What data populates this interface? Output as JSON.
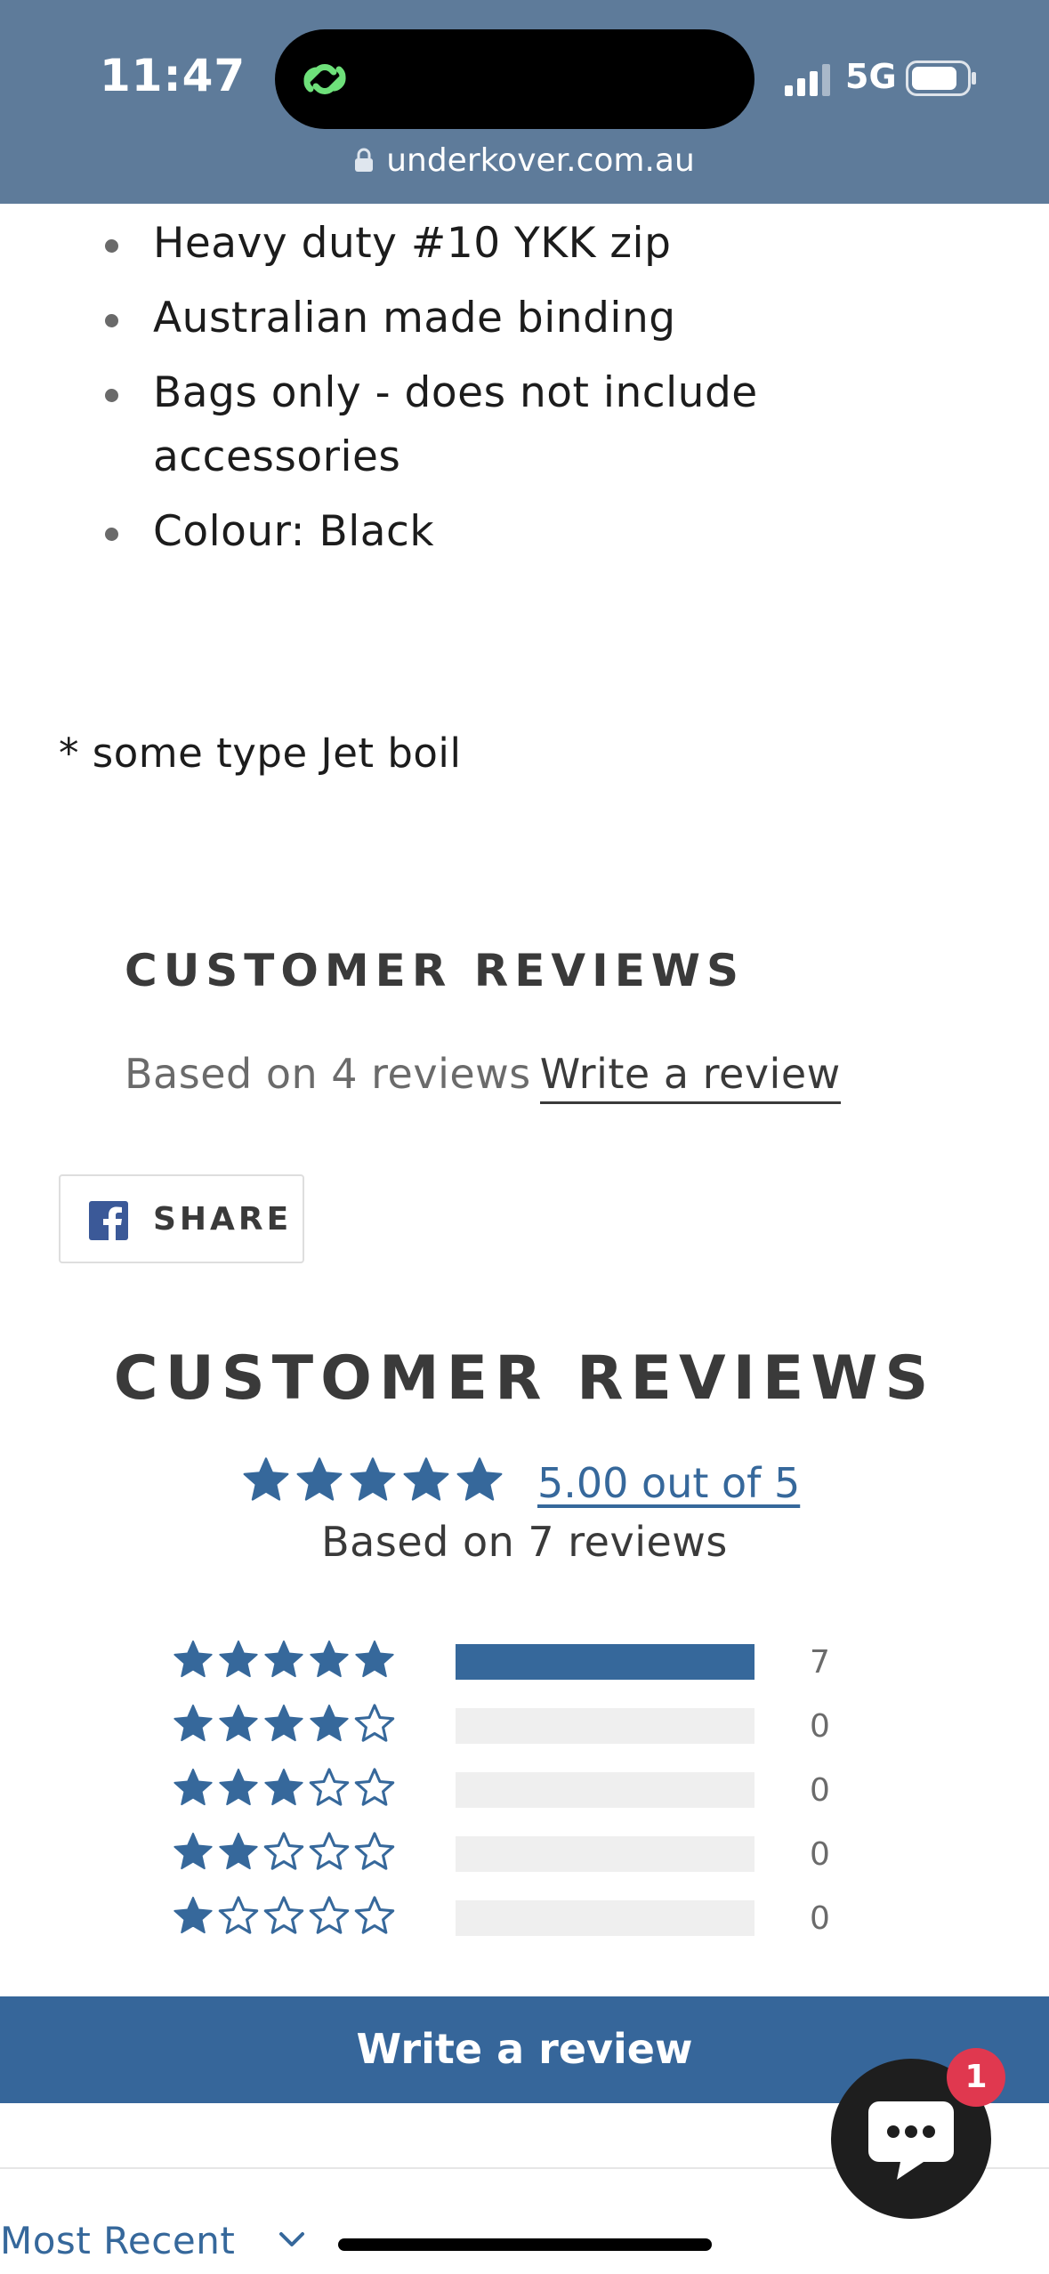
{
  "status_bar": {
    "time": "11:47",
    "network": "5G",
    "url": "underkover.com.au"
  },
  "product": {
    "features": [
      "Heavy duty #10 YKK zip",
      "Australian made binding",
      "Bags only - does not include accessories",
      "Colour: Black"
    ],
    "note": "* some type Jet boil"
  },
  "reviews_header": {
    "title": "CUSTOMER REVIEWS",
    "based_on": "Based on 4 reviews",
    "write_link": "Write a review"
  },
  "share": {
    "label": "SHARE",
    "icon": "facebook-icon"
  },
  "reviews_widget": {
    "title": "CUSTOMER REVIEWS",
    "average_stars": 5,
    "summary": "5.00 out of 5",
    "based_on": "Based on 7 reviews",
    "histogram": [
      {
        "stars": 5,
        "count": "7",
        "fraction": 1.0
      },
      {
        "stars": 4,
        "count": "0",
        "fraction": 0
      },
      {
        "stars": 3,
        "count": "0",
        "fraction": 0
      },
      {
        "stars": 2,
        "count": "0",
        "fraction": 0
      },
      {
        "stars": 1,
        "count": "0",
        "fraction": 0
      }
    ],
    "write_button": "Write a review",
    "sort_label": "Most Recent"
  },
  "chat": {
    "badge_count": "1"
  },
  "colors": {
    "status_bar": "#5e7b9a",
    "accent": "#36689b",
    "badge": "#e0384f"
  }
}
